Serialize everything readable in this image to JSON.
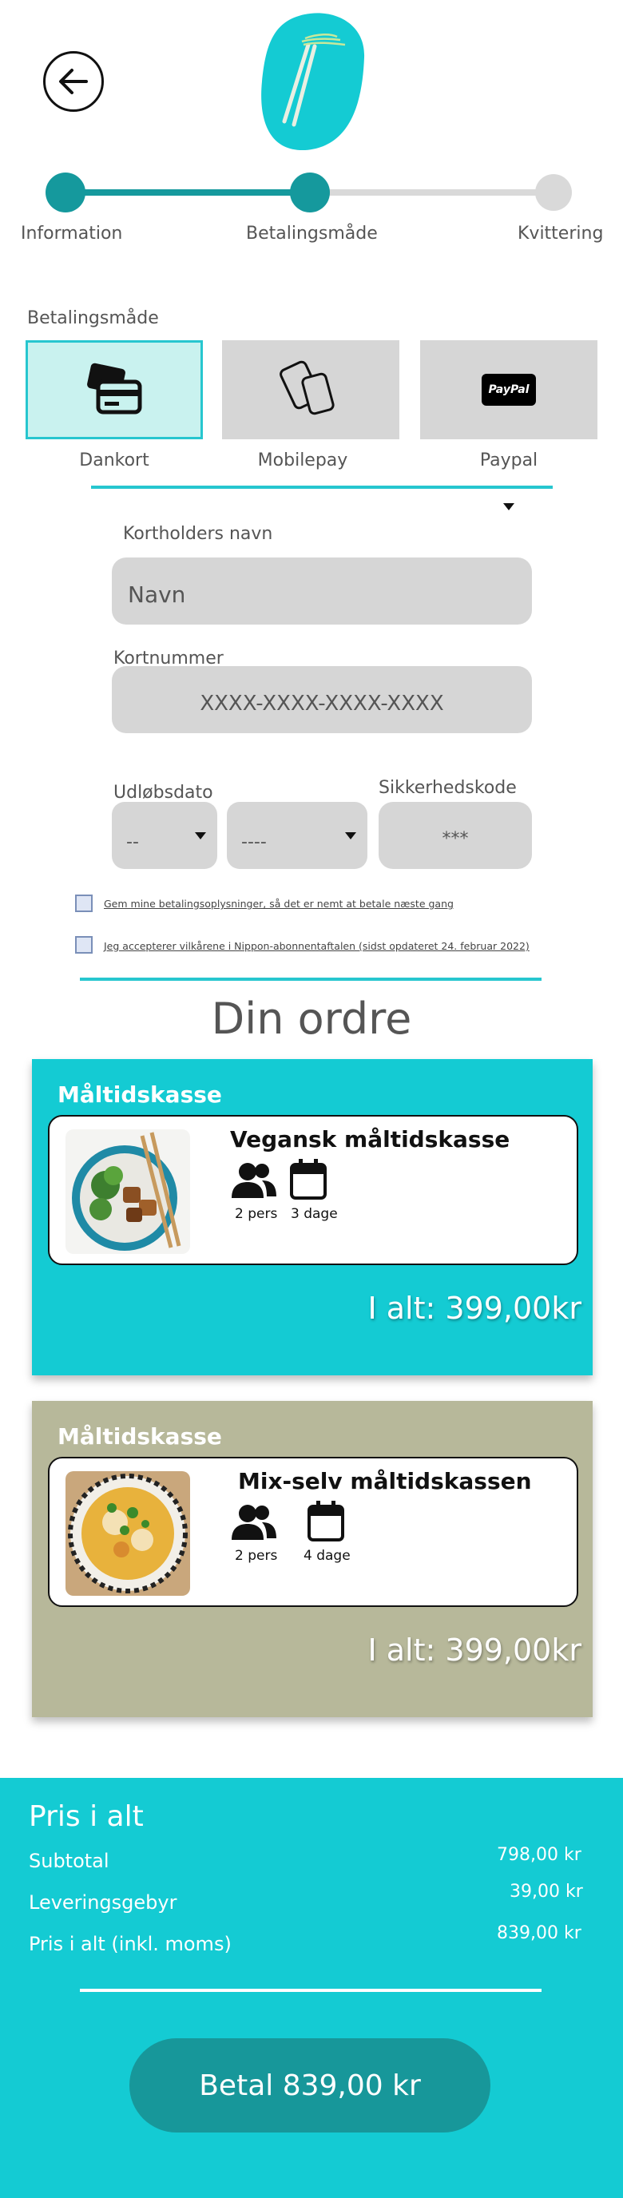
{
  "progress": {
    "steps": [
      {
        "label": "Information"
      },
      {
        "label": "Betalingsmåde"
      },
      {
        "label": "Kvittering"
      }
    ],
    "accent": "#15999d",
    "inactive": "#d9d9d9"
  },
  "payment": {
    "section_label": "Betalingsmåde",
    "methods": [
      {
        "label": "Dankort",
        "icon": "card-icon",
        "selected": true
      },
      {
        "label": "Mobilepay",
        "icon": "mobilepay-icon",
        "selected": false
      },
      {
        "label": "Paypal",
        "icon": "paypal-logo",
        "badge": "PayPal",
        "selected": false
      }
    ]
  },
  "form": {
    "cardholder_label": "Kortholders navn",
    "cardholder_placeholder": "Navn",
    "cardnumber_label": "Kortnummer",
    "cardnumber_placeholder": "XXXX-XXXX-XXXX-XXXX",
    "expiry_label": "Udløbsdato",
    "expiry_month": "--",
    "expiry_year": "----",
    "cvc_label": "Sikkerhedskode",
    "cvc_placeholder": "***",
    "save_info_text": "Gem mine betalingsoplysninger, så det er nemt at betale næste gang",
    "accept_terms_text": "Jeg accepterer vilkårene i Nippon-abonnentaftalen (sidst opdateret 24. februar 2022)"
  },
  "order": {
    "title": "Din ordre",
    "items": [
      {
        "heading": "Måltidskasse",
        "name": "Vegansk måltidskasse",
        "persons": "2 pers",
        "days": "3 dage",
        "total": "I alt: 399,00kr",
        "bg": "#14cbd3"
      },
      {
        "heading": "Måltidskasse",
        "name": "Mix-selv måltidskassen",
        "persons": "2 pers",
        "days": "4 dage",
        "total": "I alt: 399,00kr",
        "bg": "#b7b89a"
      }
    ]
  },
  "summary": {
    "title": "Pris i alt",
    "rows": [
      {
        "label": "Subtotal",
        "value": "798,00 kr"
      },
      {
        "label": "Leveringsgebyr",
        "value": "39,00 kr"
      },
      {
        "label": "Pris i alt (inkl. moms)",
        "value": "839,00 kr"
      }
    ],
    "pay_button": "Betal 839,00 kr"
  }
}
